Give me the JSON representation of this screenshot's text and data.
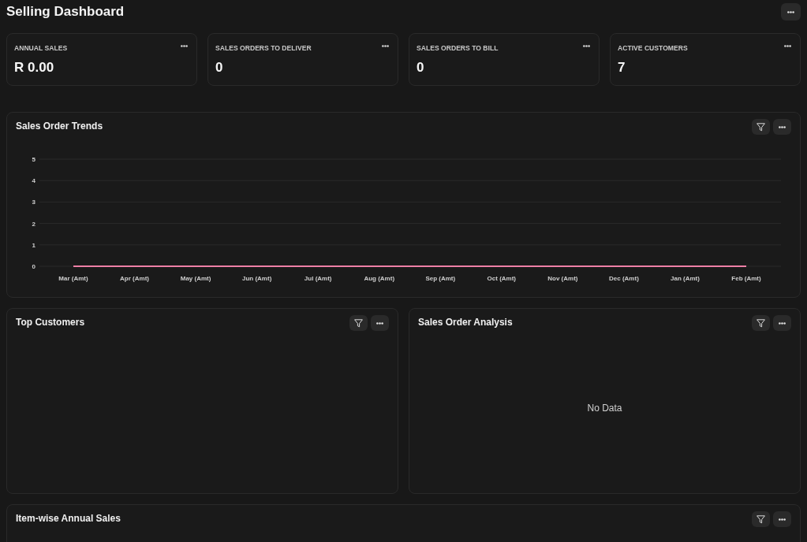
{
  "page": {
    "title": "Selling Dashboard"
  },
  "number_cards": [
    {
      "label": "ANNUAL SALES",
      "value": "R 0.00"
    },
    {
      "label": "SALES ORDERS TO DELIVER",
      "value": "0"
    },
    {
      "label": "SALES ORDERS TO BILL",
      "value": "0"
    },
    {
      "label": "ACTIVE CUSTOMERS",
      "value": "7"
    }
  ],
  "chart_rows": [
    [
      {
        "title": "Sales Order Trends",
        "chart_data": {
          "type": "line",
          "categories": [
            "Mar (Amt)",
            "Apr (Amt)",
            "May (Amt)",
            "Jun (Amt)",
            "Jul (Amt)",
            "Aug (Amt)",
            "Sep (Amt)",
            "Oct (Amt)",
            "Nov (Amt)",
            "Dec (Amt)",
            "Jan (Amt)",
            "Feb (Amt)"
          ],
          "series": [
            {
              "color": "#ee7fa6",
              "values": [
                0,
                0,
                0,
                0,
                0,
                0,
                0,
                0,
                0,
                0,
                0,
                0
              ]
            }
          ],
          "ylim": [
            0,
            5
          ],
          "yticks": [
            0,
            1,
            2,
            3,
            4,
            5
          ],
          "grid": true
        }
      }
    ],
    [
      {
        "title": "Top Customers"
      },
      {
        "title": "Sales Order Analysis",
        "message": "No Data"
      }
    ],
    [
      {
        "title": "Item-wise Annual Sales"
      }
    ]
  ]
}
